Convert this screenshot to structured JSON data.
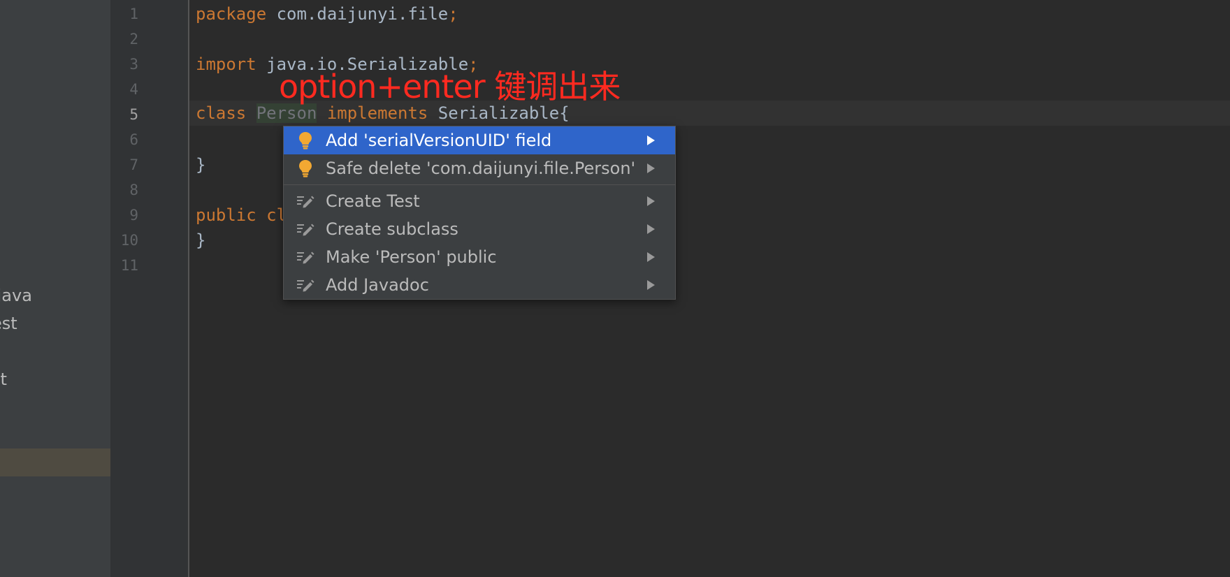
{
  "sidebar": {
    "items": [
      {
        "label": "t"
      },
      {
        "label": ".java"
      },
      {
        "label": "est"
      },
      {
        "label": "st"
      }
    ]
  },
  "gutter": {
    "line_numbers": [
      "1",
      "2",
      "3",
      "4",
      "5",
      "6",
      "7",
      "8",
      "9",
      "10",
      "11"
    ],
    "current_line": "5"
  },
  "code": {
    "line1": {
      "kw": "package",
      "rest": " com.daijunyi.file",
      "semi": ";"
    },
    "line3": {
      "kw": "import",
      "rest": " java.io.Serializable",
      "semi": ";"
    },
    "line5": {
      "kw1": "class",
      "name": "Person",
      "kw2": "implements",
      "rest": " Serializable{"
    },
    "line7": "}",
    "line9": {
      "kw": "public",
      "rest": " cl"
    },
    "line10": "}"
  },
  "annotation": {
    "text": "option+enter 键调出来",
    "color": "#ff2a20"
  },
  "popup": {
    "items": [
      {
        "label": "Add 'serialVersionUID' field",
        "icon": "lightbulb-icon",
        "selected": true
      },
      {
        "label": "Safe delete 'com.daijunyi.file.Person'",
        "icon": "lightbulb-icon",
        "selected": false
      },
      {
        "label": "Create Test",
        "icon": "intention-pencil-icon",
        "selected": false
      },
      {
        "label": "Create subclass",
        "icon": "intention-pencil-icon",
        "selected": false
      },
      {
        "label": "Make 'Person' public",
        "icon": "intention-pencil-icon",
        "selected": false
      },
      {
        "label": "Add Javadoc",
        "icon": "intention-pencil-icon",
        "selected": false
      }
    ]
  },
  "colors": {
    "selected_bg": "#2f65ca",
    "keyword": "#cc7832",
    "bulb": "#f2a832"
  }
}
